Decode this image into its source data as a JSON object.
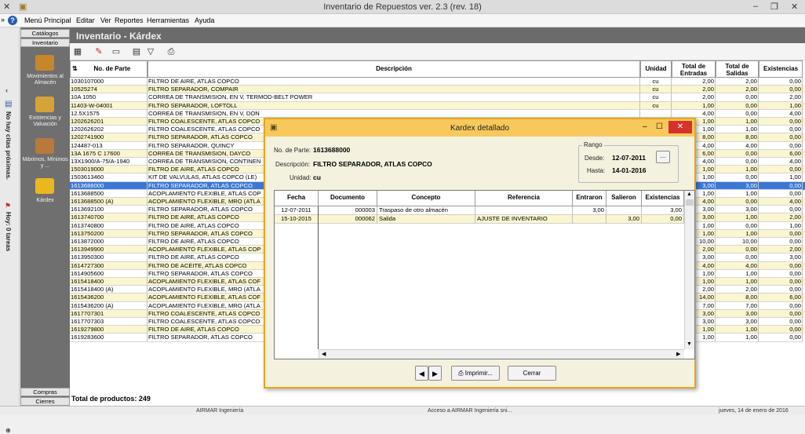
{
  "window": {
    "title": "Inventario de Repuestos ver. 2.3  (rev. 18)"
  },
  "menu": [
    "Menú Principal",
    "Editar",
    "Ver",
    "Reportes",
    "Herramientas",
    "Ayuda"
  ],
  "left_strip": {
    "agenda": "No hay citas próximas.",
    "tasks": "Hoy: 0 tareas"
  },
  "nav": {
    "tabs_top": [
      "Catálogos",
      "Inventario"
    ],
    "items": [
      "Movimientos al Almacén",
      "Existencias y Valuación",
      "Máximos, Mínimos y ...",
      "Kárdex"
    ],
    "tabs_bottom": [
      "Compras",
      "Cierres"
    ]
  },
  "main": {
    "header": "Inventario - Kárdex"
  },
  "grid": {
    "columns": [
      "No. de Parte",
      "Descripción",
      "Unidad",
      "Total de Entradas",
      "Total de Salidas",
      "Existencias"
    ],
    "rows": [
      [
        "1030107000",
        "FILTRO DE AIRE, ATLAS COPCO",
        "cu",
        "2,00",
        "2,00",
        "0,00"
      ],
      [
        "10525274",
        "FILTRO SEPARADOR, COMPAIR",
        "cu",
        "2,00",
        "2,00",
        "0,00"
      ],
      [
        "10A 1050",
        "CORREA DE TRANSMISION, EN V, TERMOD-BELT POWER",
        "cu",
        "2,00",
        "0,00",
        "2,00"
      ],
      [
        "11403-W-04001",
        "FILTRO SEPARADOR, LOFTOLL",
        "cu",
        "1,00",
        "0,00",
        "1,00"
      ],
      [
        "12.5X1575",
        "CORREA DE TRANSMISION, EN V, DON",
        "",
        "4,00",
        "0,00",
        "4,00"
      ],
      [
        "1202626201",
        "FILTRO COALESCENTE, ATLAS COPCO",
        "",
        "1,00",
        "1,00",
        "0,00"
      ],
      [
        "1202626202",
        "FILTRO COALESCENTE, ATLAS COPCO",
        "",
        "1,00",
        "1,00",
        "0,00"
      ],
      [
        "1202741900",
        "FILTRO SEPARADOR, ATLAS COPCO",
        "",
        "8,00",
        "8,00",
        "0,00"
      ],
      [
        "124487-013",
        "FILTRO SEPARADOR, QUINCY",
        "",
        "4,00",
        "4,00",
        "0,00"
      ],
      [
        "13A 1675 C 17600",
        "CORREA DE TRANSMISION, DAYCO",
        "",
        "6,00",
        "0,00",
        "6,00"
      ],
      [
        "13X1900/A-75/A-1940",
        "CORREA DE TRANSMISION, CONTINEN",
        "",
        "4,00",
        "0,00",
        "4,00"
      ],
      [
        "1503019000",
        "FILTRO DE AIRE, ATLAS COPCO",
        "",
        "1,00",
        "1,00",
        "0,00"
      ],
      [
        "1503613460",
        "KIT DE VALVULAS, ATLAS COPCO (LE)",
        "",
        "1,00",
        "0,00",
        "1,00"
      ],
      [
        "1613688000",
        "FILTRO SEPARADOR, ATLAS COPCO",
        "",
        "3,00",
        "3,00",
        "0,00"
      ],
      [
        "1613688500",
        "ACOPLAMIENTO FLEXIBLE, ATLAS COP",
        "",
        "1,00",
        "1,00",
        "0,00"
      ],
      [
        "1613688500 (A)",
        "ACOPLAMIENTO FLEXIBLE, MRO (ATLA",
        "",
        "4,00",
        "0,00",
        "4,00"
      ],
      [
        "1613692100",
        "FILTRO SEPARADOR, ATLAS COPCO",
        "",
        "3,00",
        "3,00",
        "0,00"
      ],
      [
        "1613740700",
        "FILTRO DE AIRE, ATLAS COPCO",
        "",
        "3,00",
        "1,00",
        "2,00"
      ],
      [
        "1613740800",
        "FILTRO DE AIRE, ATLAS COPCO",
        "",
        "1,00",
        "0,00",
        "1,00"
      ],
      [
        "1613750200",
        "FILTRO SEPARADOR, ATLAS COPCO",
        "",
        "1,00",
        "1,00",
        "0,00"
      ],
      [
        "1613872000",
        "FILTRO DE AIRE, ATLAS COPCO",
        "",
        "10,00",
        "10,00",
        "0,00"
      ],
      [
        "1613949900",
        "ACOPLAMIENTO FLEXIBLE, ATLAS COP",
        "",
        "2,00",
        "0,00",
        "2,00"
      ],
      [
        "1613950300",
        "FILTRO DE AIRE, ATLAS COPCO",
        "",
        "3,00",
        "0,00",
        "3,00"
      ],
      [
        "1614727300",
        "FILTRO DE ACEITE, ATLAS COPCO",
        "",
        "4,00",
        "4,00",
        "0,00"
      ],
      [
        "1614905600",
        "FILTRO SEPARADOR, ATLAS COPCO",
        "",
        "1,00",
        "1,00",
        "0,00"
      ],
      [
        "1615418400",
        "ACOPLAMIENTO FLEXIBLE, ATLAS COF",
        "",
        "1,00",
        "1,00",
        "0,00"
      ],
      [
        "1615418400 (A)",
        "ACOPLAMIENTO FLEXIBLE, MRO (ATLA",
        "",
        "2,00",
        "2,00",
        "0,00"
      ],
      [
        "1615436200",
        "ACOPLAMIENTO FLEXIBLE, ATLAS COF",
        "",
        "14,00",
        "8,00",
        "6,00"
      ],
      [
        "1615436200 (A)",
        "ACOPLAMIENTO FLEXIBLE, MRO (ATLA",
        "",
        "7,00",
        "7,00",
        "0,00"
      ],
      [
        "1617707301",
        "FILTRO COALESCENTE, ATLAS COPCO",
        "",
        "3,00",
        "3,00",
        "0,00"
      ],
      [
        "1617707303",
        "FILTRO COALESCENTE, ATLAS COPCO",
        "",
        "3,00",
        "3,00",
        "0,00"
      ],
      [
        "1619279800",
        "FILTRO DE AIRE, ATLAS COPCO",
        "",
        "1,00",
        "1,00",
        "0,00"
      ],
      [
        "1619283600",
        "FILTRO SEPARADOR, ATLAS COPCO",
        "cu",
        "1,00",
        "1,00",
        "0,00"
      ]
    ],
    "selected_row": 13,
    "total_label": "Total de productos: 249"
  },
  "dialog": {
    "title": "Kardex detallado",
    "part_label": "No. de Parte:",
    "part_value": "1613688000",
    "desc_label": "Descripción:",
    "desc_value": "FILTRO SEPARADOR, ATLAS COPCO",
    "unit_label": "Unidad:",
    "unit_value": "cu",
    "rango_label": "Rango",
    "desde_label": "Desde:",
    "desde_value": "12-07-2011",
    "hasta_label": "Hasta:",
    "hasta_value": "14-01-2016",
    "range_button": "...",
    "columns": [
      "Fecha",
      "Documento",
      "Concepto",
      "Referencia",
      "Entraron",
      "Salieron",
      "Existencias"
    ],
    "rows": [
      [
        "12-07-2011",
        "000003",
        "Traspaso de otro almacén",
        "",
        "3,00",
        "",
        "3,00"
      ],
      [
        "15-10-2015",
        "000062",
        "Salida",
        "AJUSTE DE INVENTARIO",
        "",
        "3,00",
        "0,00"
      ]
    ],
    "print_button": "Imprimir...",
    "close_button": "Cerrar"
  },
  "taskbar": {
    "left": "AIRMAR Ingeniería",
    "middle": "Acceso a AIRMAR Ingeniería sni...",
    "right": "jueves, 14 de enero de 2016"
  },
  "colors": {
    "accent": "#f7c95c",
    "row_alt": "#fbf6cf",
    "selected": "#3a78d6",
    "nav_bg": "#6f6f6f"
  }
}
